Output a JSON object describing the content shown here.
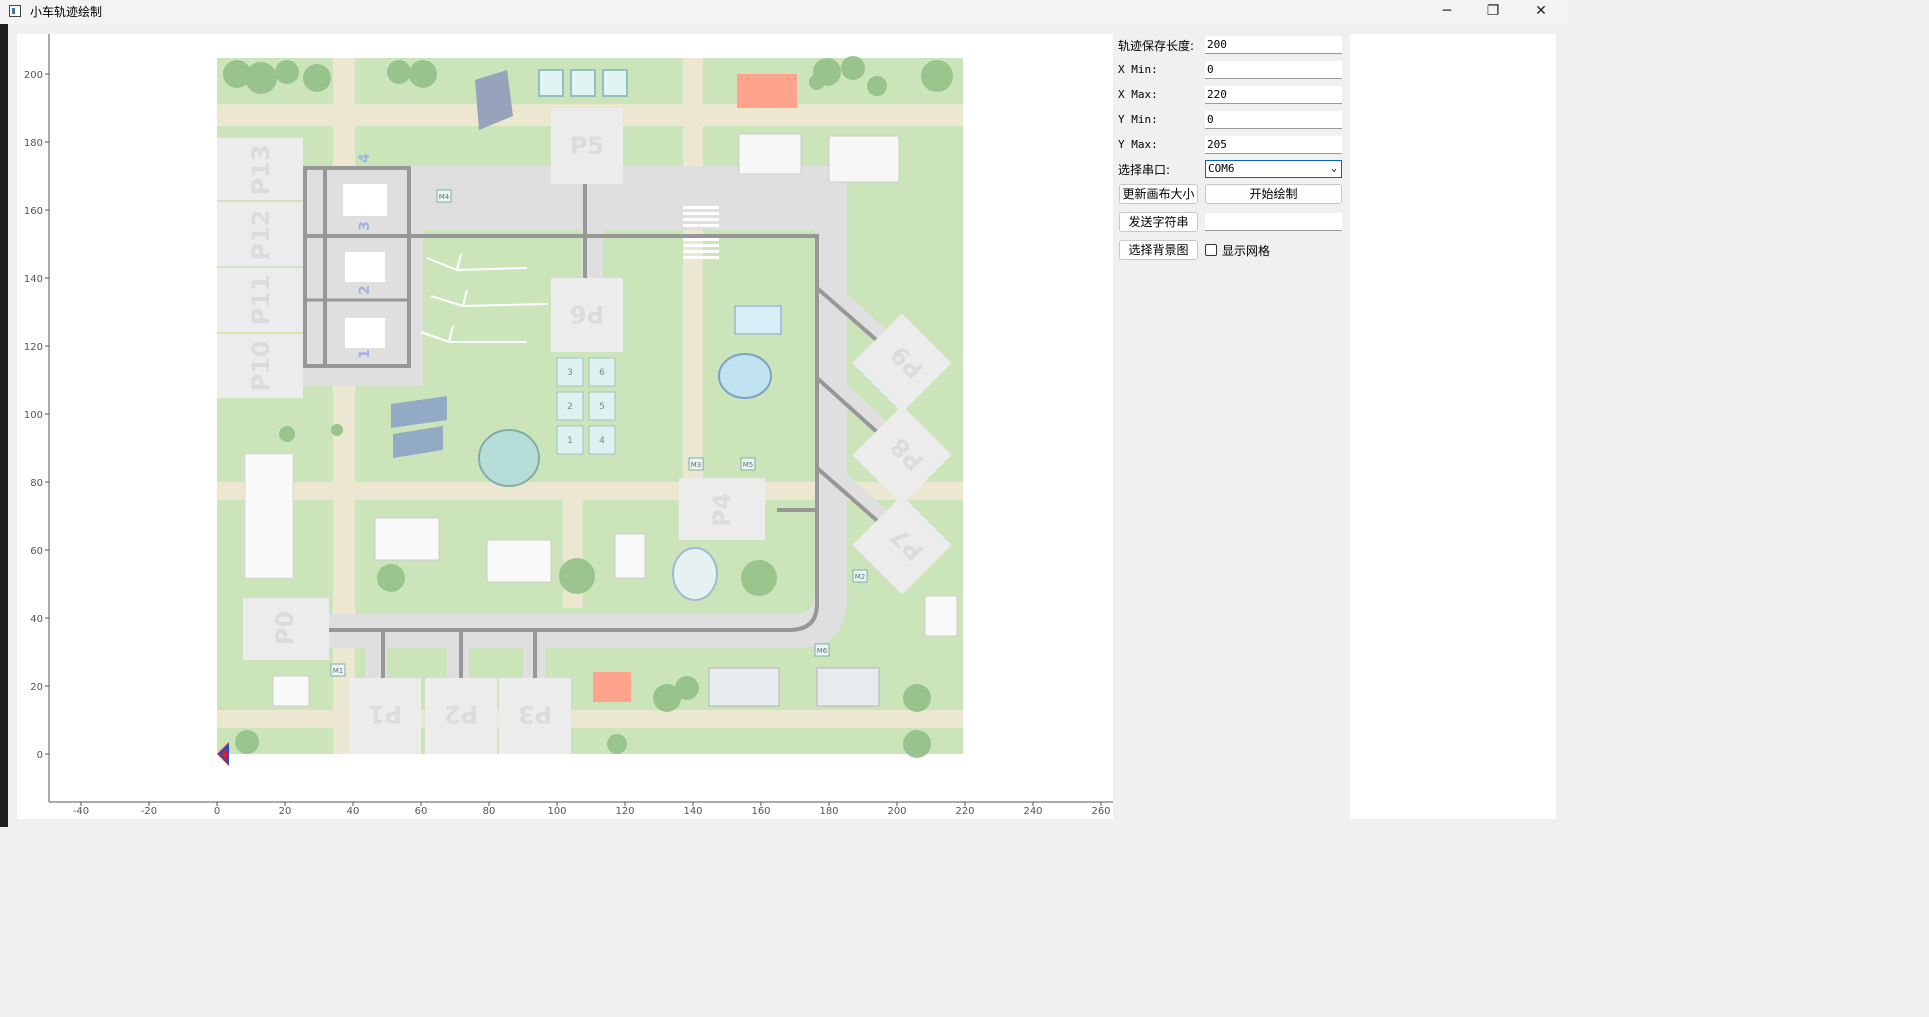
{
  "window": {
    "title": "小车轨迹绘制",
    "controls": {
      "minimize": "─",
      "maximize": "❐",
      "close": "✕"
    }
  },
  "plot": {
    "x_ticks": [
      "-40",
      "-20",
      "0",
      "20",
      "40",
      "60",
      "80",
      "100",
      "120",
      "140",
      "160",
      "180",
      "200",
      "220",
      "240",
      "260"
    ],
    "y_ticks": [
      "0",
      "20",
      "40",
      "60",
      "80",
      "100",
      "120",
      "140",
      "160",
      "180",
      "200"
    ],
    "map": {
      "parking_labels": [
        "P0",
        "P1",
        "P2",
        "P3",
        "P4",
        "P5",
        "P6",
        "P7",
        "P8",
        "P9",
        "P10",
        "P11",
        "P12",
        "P13"
      ],
      "bay_numbers": [
        "1",
        "2",
        "3",
        "4"
      ],
      "grid_numbers": [
        "1",
        "2",
        "3",
        "4",
        "5",
        "6"
      ],
      "markers": [
        "M1",
        "M2",
        "M3",
        "M4",
        "M5",
        "M6"
      ]
    },
    "colors": {
      "grass": "#b8dba0",
      "road": "#d4d4d4",
      "road_line": "#707070",
      "parking": "#e6e6e6",
      "parking_text": "#cfcfcf",
      "car_marker_red": "#e02020",
      "car_marker_blue": "#2050d0"
    }
  },
  "panel": {
    "track_length": {
      "label": "轨迹保存长度:",
      "value": "200"
    },
    "x_min": {
      "label": "X Min:",
      "value": "0"
    },
    "x_max": {
      "label": "X Max:",
      "value": "220"
    },
    "y_min": {
      "label": "Y Min:",
      "value": "0"
    },
    "y_max": {
      "label": "Y Max:",
      "value": "205"
    },
    "serial": {
      "label": "选择串口:",
      "value": "COM6"
    },
    "update_canvas_button": "更新画布大小",
    "start_button": "开始绘制",
    "send_string_button": "发送字符串",
    "send_string_value": "",
    "choose_bg_button": "选择背景图",
    "show_grid_label": "显示网格",
    "show_grid_checked": false
  }
}
